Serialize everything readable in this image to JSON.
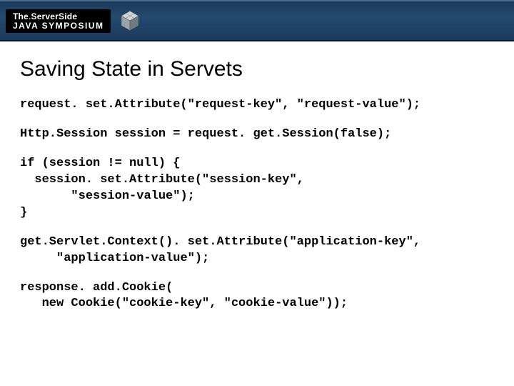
{
  "header": {
    "logo_top_a": "The",
    "logo_top_dot": ".",
    "logo_top_b": "ServerSide",
    "logo_bottom": "JAVA SYMPOSIUM"
  },
  "slide": {
    "title": "Saving State in Servets",
    "code": {
      "b1": "request. set.Attribute(\"request-key\", \"request-value\");",
      "b2": "Http.Session session = request. get.Session(false);",
      "b3": "if (session != null) {\n  session. set.Attribute(\"session-key\",\n       \"session-value\");\n}",
      "b4": "get.Servlet.Context(). set.Attribute(\"application-key\",\n     \"application-value\");",
      "b5": "response. add.Cookie(\n   new Cookie(\"cookie-key\", \"cookie-value\"));"
    }
  }
}
